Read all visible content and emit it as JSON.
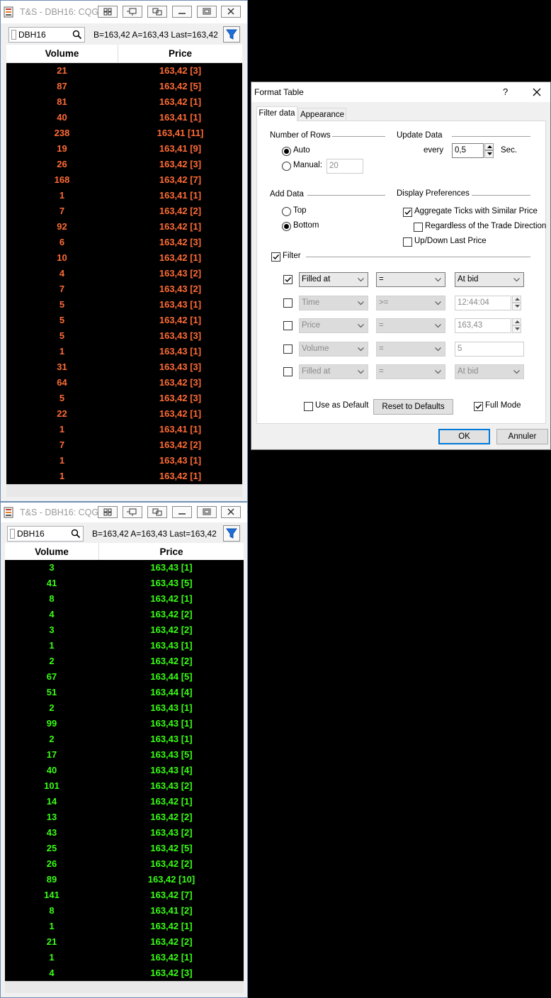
{
  "tsWindow": {
    "title": "T&S - DBH16: CQG",
    "symbol": "DBH16",
    "quote": "B=163,42 A=163,43 Last=163,42",
    "columns": [
      "Volume",
      "Price"
    ]
  },
  "colors": {
    "sell": "#ff6b35",
    "buy": "#39ff14",
    "accent": "#0078d7"
  },
  "topRows": [
    [
      "21",
      "163,42 [3]"
    ],
    [
      "87",
      "163,42 [5]"
    ],
    [
      "81",
      "163,42 [1]"
    ],
    [
      "40",
      "163,41 [1]"
    ],
    [
      "238",
      "163,41 [11]"
    ],
    [
      "19",
      "163,41 [9]"
    ],
    [
      "26",
      "163,42 [3]"
    ],
    [
      "168",
      "163,42 [7]"
    ],
    [
      "1",
      "163,41 [1]"
    ],
    [
      "7",
      "163,42 [2]"
    ],
    [
      "92",
      "163,42 [1]"
    ],
    [
      "6",
      "163,42 [3]"
    ],
    [
      "10",
      "163,42 [1]"
    ],
    [
      "4",
      "163,43 [2]"
    ],
    [
      "7",
      "163,43 [2]"
    ],
    [
      "5",
      "163,43 [1]"
    ],
    [
      "5",
      "163,42 [1]"
    ],
    [
      "5",
      "163,43 [3]"
    ],
    [
      "1",
      "163,43 [1]"
    ],
    [
      "31",
      "163,43 [3]"
    ],
    [
      "64",
      "163,42 [3]"
    ],
    [
      "5",
      "163,42 [3]"
    ],
    [
      "22",
      "163,42 [1]"
    ],
    [
      "1",
      "163,41 [1]"
    ],
    [
      "7",
      "163,42 [2]"
    ],
    [
      "1",
      "163,43 [1]"
    ],
    [
      "1",
      "163,42 [1]"
    ]
  ],
  "bottomRows": [
    [
      "3",
      "163,43 [1]"
    ],
    [
      "41",
      "163,43 [5]"
    ],
    [
      "8",
      "163,42 [1]"
    ],
    [
      "4",
      "163,42 [2]"
    ],
    [
      "3",
      "163,42 [2]"
    ],
    [
      "1",
      "163,43 [1]"
    ],
    [
      "2",
      "163,42 [2]"
    ],
    [
      "67",
      "163,44 [5]"
    ],
    [
      "51",
      "163,44 [4]"
    ],
    [
      "2",
      "163,43 [1]"
    ],
    [
      "99",
      "163,43 [1]"
    ],
    [
      "2",
      "163,43 [1]"
    ],
    [
      "17",
      "163,43 [5]"
    ],
    [
      "40",
      "163,43 [4]"
    ],
    [
      "101",
      "163,43 [2]"
    ],
    [
      "14",
      "163,42 [1]"
    ],
    [
      "13",
      "163,42 [2]"
    ],
    [
      "43",
      "163,43 [2]"
    ],
    [
      "25",
      "163,42 [5]"
    ],
    [
      "26",
      "163,42 [2]"
    ],
    [
      "89",
      "163,42 [10]"
    ],
    [
      "141",
      "163,42 [7]"
    ],
    [
      "8",
      "163,41 [2]"
    ],
    [
      "1",
      "163,42 [1]"
    ],
    [
      "21",
      "163,42 [2]"
    ],
    [
      "1",
      "163,42 [1]"
    ],
    [
      "4",
      "163,42 [3]"
    ]
  ],
  "dialog": {
    "title": "Format Table",
    "help": "?",
    "tabs": [
      "Filter data",
      "Appearance"
    ],
    "numberOfRows": {
      "label": "Number of Rows",
      "auto": "Auto",
      "manual": "Manual:",
      "manualValue": "20",
      "selected": "Auto"
    },
    "updateData": {
      "label": "Update Data",
      "every": "every",
      "value": "0,5",
      "unit": "Sec."
    },
    "addData": {
      "label": "Add Data",
      "top": "Top",
      "bottom": "Bottom",
      "selected": "Bottom"
    },
    "displayPrefs": {
      "label": "Display Preferences",
      "aggregate": "Aggregate Ticks with Similar Price",
      "aggregateChecked": true,
      "regardless": "Regardless of the Trade Direction",
      "regardlessChecked": false,
      "upDown": "Up/Down Last Price",
      "upDownChecked": false
    },
    "filter": {
      "label": "Filter",
      "checked": true,
      "rows": [
        {
          "enabled": true,
          "field": "Filled at",
          "op": "=",
          "value": "At bid",
          "kind": "combo"
        },
        {
          "enabled": false,
          "field": "Time",
          "op": ">=",
          "value": "12:44:04",
          "kind": "spin"
        },
        {
          "enabled": false,
          "field": "Price",
          "op": "=",
          "value": "163,43",
          "kind": "spin"
        },
        {
          "enabled": false,
          "field": "Volume",
          "op": "=",
          "value": "5",
          "kind": "text"
        },
        {
          "enabled": false,
          "field": "Filled at",
          "op": "=",
          "value": "At bid",
          "kind": "combo"
        }
      ]
    },
    "useAsDefault": "Use as Default",
    "resetToDefaults": "Reset to Defaults",
    "fullMode": "Full Mode",
    "fullModeChecked": true,
    "ok": "OK",
    "cancel": "Annuler"
  }
}
